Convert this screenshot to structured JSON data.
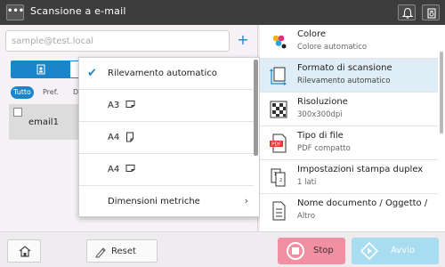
{
  "header": {
    "title": "Scansione a e-mail",
    "menu_label": "•••"
  },
  "address": {
    "placeholder": "sample@test.local",
    "add_label": "+"
  },
  "filters": {
    "all": "Tutto",
    "pref": "Pref.",
    "next": "D"
  },
  "contacts": [
    {
      "label": "email1"
    }
  ],
  "dropdown": {
    "items": [
      {
        "label": "Rilevamento automatico",
        "checked": true
      },
      {
        "label": "A3",
        "orientation": "landscape"
      },
      {
        "label": "A4",
        "orientation": "portrait"
      },
      {
        "label": "A4",
        "orientation": "landscape"
      },
      {
        "label": "Dimensioni metriche",
        "submenu": true
      }
    ],
    "chevron": "›",
    "check": "✔"
  },
  "settings": [
    {
      "title": "Colore",
      "sub": "Colore automatico",
      "icon": "color-icon"
    },
    {
      "title": "Formato di scansione",
      "sub": "Rilevamento automatico",
      "icon": "scan-size-icon",
      "selected": true
    },
    {
      "title": "Risoluzione",
      "sub": "300x300dpi",
      "icon": "resolution-icon"
    },
    {
      "title": "Tipo di file",
      "sub": "PDF compatto",
      "icon": "pdf-icon",
      "icon_text": "PDF"
    },
    {
      "title": "Impostazioni stampa duplex",
      "sub": "1 lati",
      "icon": "duplex-icon"
    },
    {
      "title": "Nome documento / Oggetto /",
      "sub": "Altro",
      "icon": "document-icon"
    }
  ],
  "footer": {
    "reset_label": "Reset",
    "stop_label": "Stop",
    "start_label": "Avvio"
  },
  "colors": {
    "accent": "#1a86c9",
    "selected_bg": "#dfeef6",
    "stop": "#f28fa2",
    "start": "#a8dcf0",
    "pdf_red": "#e23b2e"
  }
}
